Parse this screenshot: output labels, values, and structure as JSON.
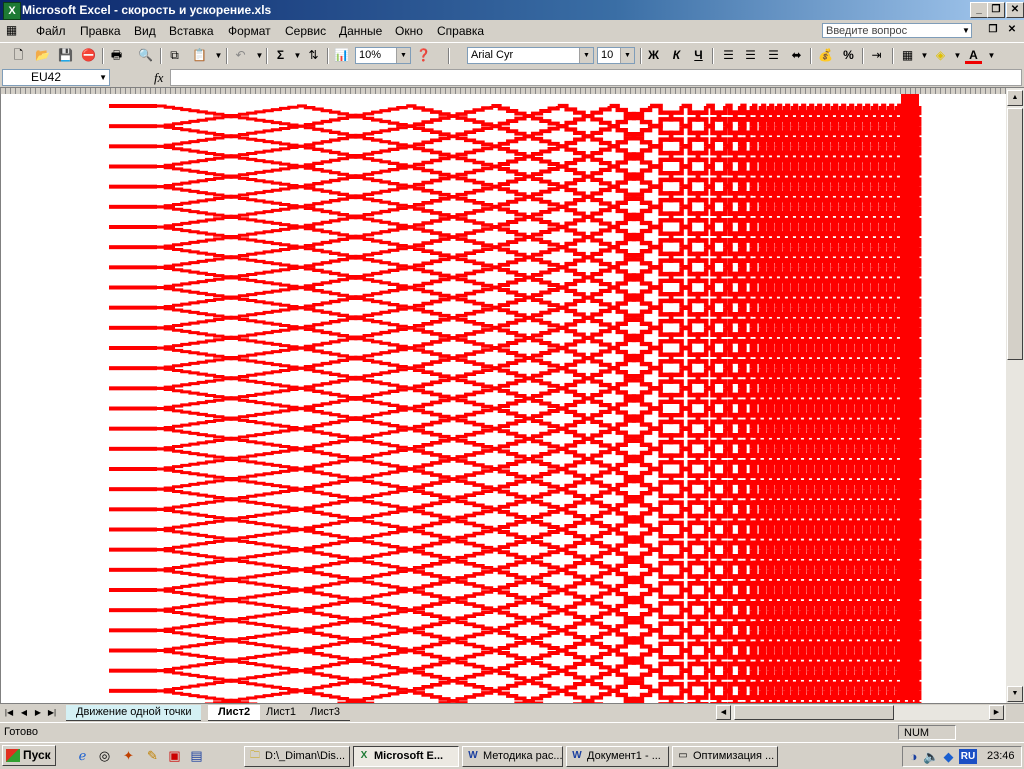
{
  "window": {
    "title": "Microsoft Excel - скорость и ускорение.xls",
    "app_icon": "X"
  },
  "menu": {
    "items": [
      "Файл",
      "Правка",
      "Вид",
      "Вставка",
      "Формат",
      "Сервис",
      "Данные",
      "Окно",
      "Справка"
    ],
    "help_placeholder": "Введите вопрос"
  },
  "toolbar": {
    "zoom": "10%",
    "font_name": "Arial Cyr",
    "font_size": "10",
    "sum_glyph": "Σ",
    "bold_glyph": "Ж",
    "italic_glyph": "К",
    "underline_glyph": "Ч",
    "percent_glyph": "%",
    "font_color_glyph": "A"
  },
  "formula_bar": {
    "cell_ref": "EU42",
    "fx_label": "fx",
    "value": ""
  },
  "sheets": {
    "tabs": [
      "Движение одной точки",
      "Лист2",
      "Лист1",
      "Лист3"
    ],
    "active": "Лист2"
  },
  "status": {
    "text": "Готово",
    "num": "NUM"
  },
  "taskbar": {
    "start_label": "Пуск",
    "tasks": [
      "D:\\_Diman\\Dis...",
      "Microsoft E...",
      "Методика рас...",
      "Документ1 - ...",
      "Оптимизация ..."
    ],
    "active_task": "Microsoft E...",
    "language": "RU",
    "clock": "23:46"
  },
  "colors": {
    "pattern": "#ff0000",
    "sheet_tab_first": "#d4f0f4"
  },
  "icons": [
    "app-excel-icon",
    "new-icon",
    "open-icon",
    "save-icon",
    "permission-icon",
    "print-icon",
    "research-icon",
    "copy-icon",
    "paste-icon",
    "undo-icon",
    "autosum-icon",
    "sort-icon",
    "chart-wizard-icon",
    "help-icon",
    "align-left-icon",
    "center-icon",
    "align-right-icon",
    "merge-icon",
    "currency-icon",
    "indent-icon",
    "borders-icon",
    "fill-color-icon"
  ]
}
